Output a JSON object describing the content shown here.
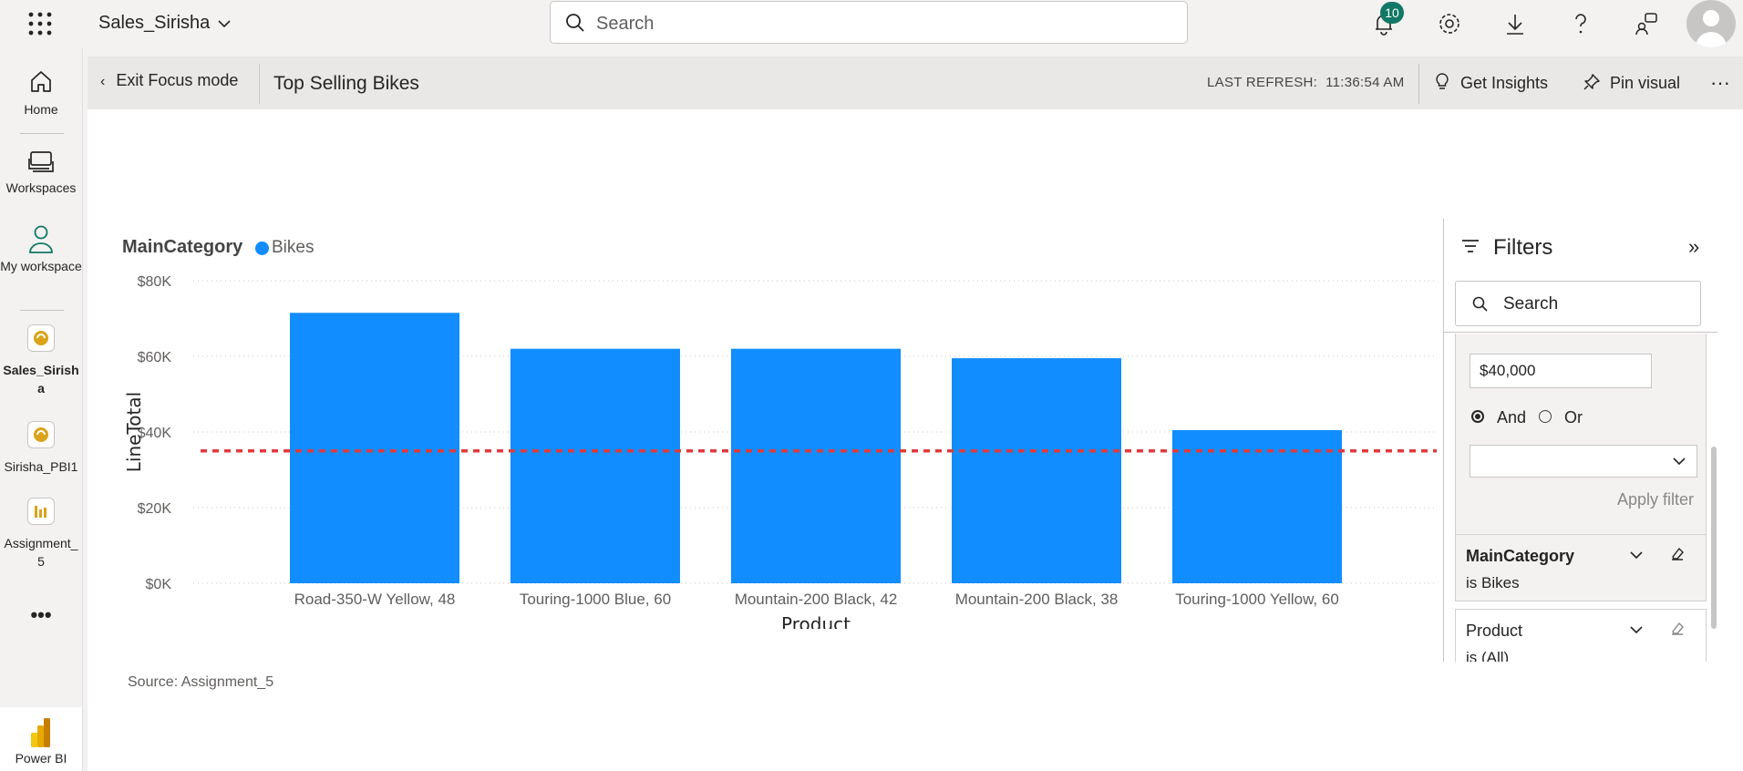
{
  "topbar": {
    "workspace_title": "Sales_Sirisha",
    "search_placeholder": "Search",
    "notification_count": "10"
  },
  "leftnav": {
    "items": [
      {
        "label": "Home",
        "icon": "home-icon"
      },
      {
        "label": "Workspaces",
        "icon": "workspaces-icon"
      },
      {
        "label": "My workspace",
        "icon": "person-icon"
      },
      {
        "label": "Sales_Sirish a",
        "icon": "workspace-tile-icon"
      },
      {
        "label": "Sirisha_PBI1",
        "icon": "workspace-tile-icon"
      },
      {
        "label": "Assignment_ 5",
        "icon": "report-icon"
      }
    ],
    "more": "•••",
    "app_label": "Power BI"
  },
  "header": {
    "exit_focus": "Exit Focus mode",
    "visual_title": "Top Selling Bikes",
    "last_refresh_label": "LAST REFRESH:",
    "last_refresh_time": "11:36:54 AM",
    "get_insights": "Get Insights",
    "pin_visual": "Pin visual",
    "more": "···"
  },
  "chart_data": {
    "type": "bar",
    "legend_title": "MainCategory",
    "series": [
      {
        "name": "Bikes",
        "color": "#118dff",
        "values": [
          71500,
          62000,
          62000,
          59500,
          40500
        ]
      }
    ],
    "categories": [
      "Road-350-W Yellow, 48",
      "Touring-1000 Blue, 60",
      "Mountain-200 Black, 42",
      "Mountain-200 Black, 38",
      "Touring-1000 Yellow, 60"
    ],
    "yticks": [
      "$0K",
      "$20K",
      "$40K",
      "$60K",
      "$80K"
    ],
    "ylim": [
      0,
      80000
    ],
    "xlabel": "Product",
    "ylabel": "LineTotal",
    "reference_line": {
      "value": 35000,
      "color": "#e03a3e",
      "style": "dotted"
    },
    "grid": true,
    "legend_position": "top-left"
  },
  "source": "Source: Assignment_5",
  "filters": {
    "title": "Filters",
    "search_placeholder": "Search",
    "amount_value": "$40,000",
    "logic_and": "And",
    "logic_or": "Or",
    "apply_filter": "Apply filter",
    "cards": [
      {
        "name": "MainCategory",
        "value": "is Bikes"
      },
      {
        "name": "Product",
        "value": "is (All)"
      }
    ]
  },
  "colors": {
    "accent": "#118dff",
    "badge": "#117865",
    "reference": "#e03a3e"
  }
}
